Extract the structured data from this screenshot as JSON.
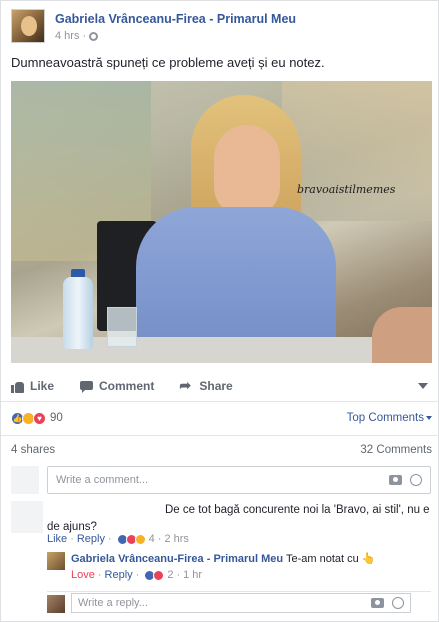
{
  "post": {
    "author": "Gabriela Vrânceanu-Firea - Primarul Meu",
    "time": "4 hrs",
    "text": "Dumneavoastră spuneți ce probleme aveți și eu notez.",
    "image_watermark": "bravoaistilmemes"
  },
  "actions": {
    "like": "Like",
    "comment": "Comment",
    "share": "Share"
  },
  "reactions": {
    "count": "90",
    "types": [
      "like",
      "haha",
      "love"
    ],
    "sort_label": "Top Comments"
  },
  "stats": {
    "shares": "4 shares",
    "comments": "32 Comments"
  },
  "composer": {
    "placeholder": "Write a comment..."
  },
  "comment": {
    "text": "De ce tot bagă concurente noi la 'Bravo, ai stil', nu e de ajuns?",
    "like": "Like",
    "reply": "Reply",
    "reaction_count": "4",
    "time": "2 hrs"
  },
  "reply": {
    "author": "Gabriela Vrânceanu-Firea - Primarul Meu",
    "text": "Te-am notat cu 👆",
    "love": "Love",
    "reply": "Reply",
    "reaction_count": "2",
    "time": "1 hr"
  },
  "reply_composer": {
    "placeholder": "Write a reply..."
  },
  "colors": {
    "link": "#365899",
    "meta": "#90949c",
    "like": "#4267b2",
    "love": "#e9425b",
    "haha": "#f7b125"
  }
}
